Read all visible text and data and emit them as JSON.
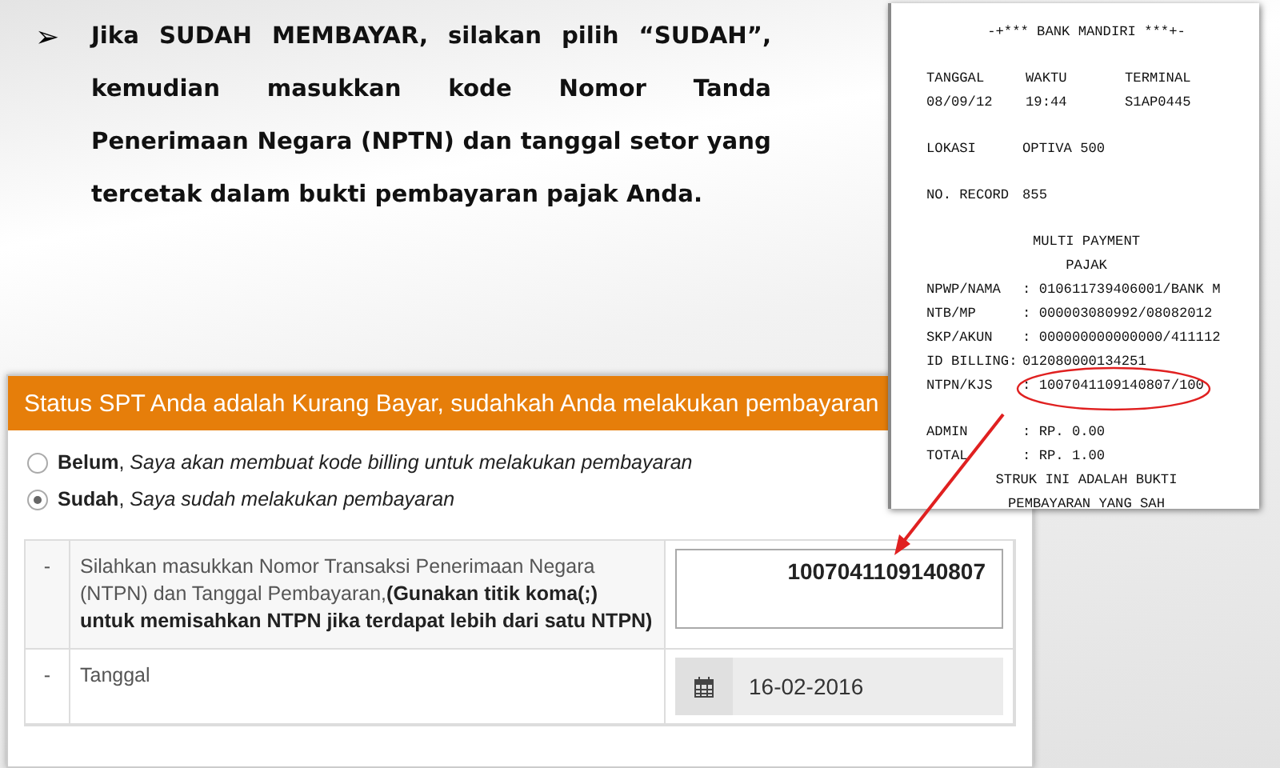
{
  "slide": {
    "bullet": "➢",
    "text": "Jika SUDAH MEMBAYAR, silakan pilih “SUDAH”, kemudian masukkan kode Nomor Tanda Penerimaan Negara (NPTN) dan tanggal setor yang tercetak dalam bukti pembayaran pajak Anda."
  },
  "form": {
    "title": "Status SPT Anda adalah Kurang Bayar, sudahkah Anda melakukan pembayaran",
    "options": [
      {
        "text": "**Belum**, *Saya akan membuat kode billing untuk melakukan pembayaran*",
        "selected": false
      },
      {
        "text": "**Sudah**, *Saya sudah melakukan pembayaran*",
        "selected": true
      }
    ],
    "rows": [
      {
        "kind": "textarea",
        "marker": "-",
        "label": "Silahkan masukkan Nomor Transaksi Penerimaan Negara (NTPN) dan Tanggal Pembayaran,**(Gunakan titik koma(;) untuk memisahkan NTPN jika terdapat lebih dari satu NTPN)**",
        "value": "1007041109140807"
      },
      {
        "kind": "date",
        "marker": "-",
        "label": "Tanggal",
        "value": "16-02-2016"
      }
    ]
  },
  "receipt": {
    "lines": [
      {
        "kind": "center",
        "cells": [
          "-+*** BANK MANDIRI ***+-"
        ]
      },
      {
        "kind": "gap"
      },
      {
        "kind": "grid",
        "cells": [
          "TANGGAL",
          "WAKTU",
          "TERMINAL"
        ]
      },
      {
        "kind": "grid",
        "cells": [
          "08/09/12",
          "19:44",
          "S1AP0445"
        ]
      },
      {
        "kind": "gap"
      },
      {
        "kind": "pair",
        "cells": [
          "LOKASI",
          "OPTIVA 500"
        ]
      },
      {
        "kind": "gap"
      },
      {
        "kind": "pair",
        "cells": [
          "NO. RECORD",
          "855"
        ]
      },
      {
        "kind": "gap"
      },
      {
        "kind": "center",
        "cells": [
          "MULTI PAYMENT"
        ]
      },
      {
        "kind": "center",
        "cells": [
          "PAJAK"
        ]
      },
      {
        "kind": "pair",
        "cells": [
          "NPWP/NAMA",
          ": 010611739406001/BANK M"
        ]
      },
      {
        "kind": "pair",
        "cells": [
          "NTB/MP",
          ": 000003080992/08082012"
        ]
      },
      {
        "kind": "pair",
        "cells": [
          "SKP/AKUN",
          ": 000000000000000/411112"
        ]
      },
      {
        "kind": "pair",
        "cells": [
          "ID BILLING:",
          "012080000134251"
        ]
      },
      {
        "kind": "pair",
        "cells": [
          "NTPN/KJS",
          ": 1007041109140807/100"
        ]
      },
      {
        "kind": "gap"
      },
      {
        "kind": "pair",
        "cells": [
          "ADMIN",
          ": RP. 0.00"
        ]
      },
      {
        "kind": "pair",
        "cells": [
          "TOTAL",
          ": RP. 1.00"
        ]
      },
      {
        "kind": "center",
        "cells": [
          "STRUK INI ADALAH BUKTI"
        ]
      },
      {
        "kind": "center",
        "cells": [
          "PEMBAYARAN YANG SAH"
        ]
      }
    ]
  }
}
